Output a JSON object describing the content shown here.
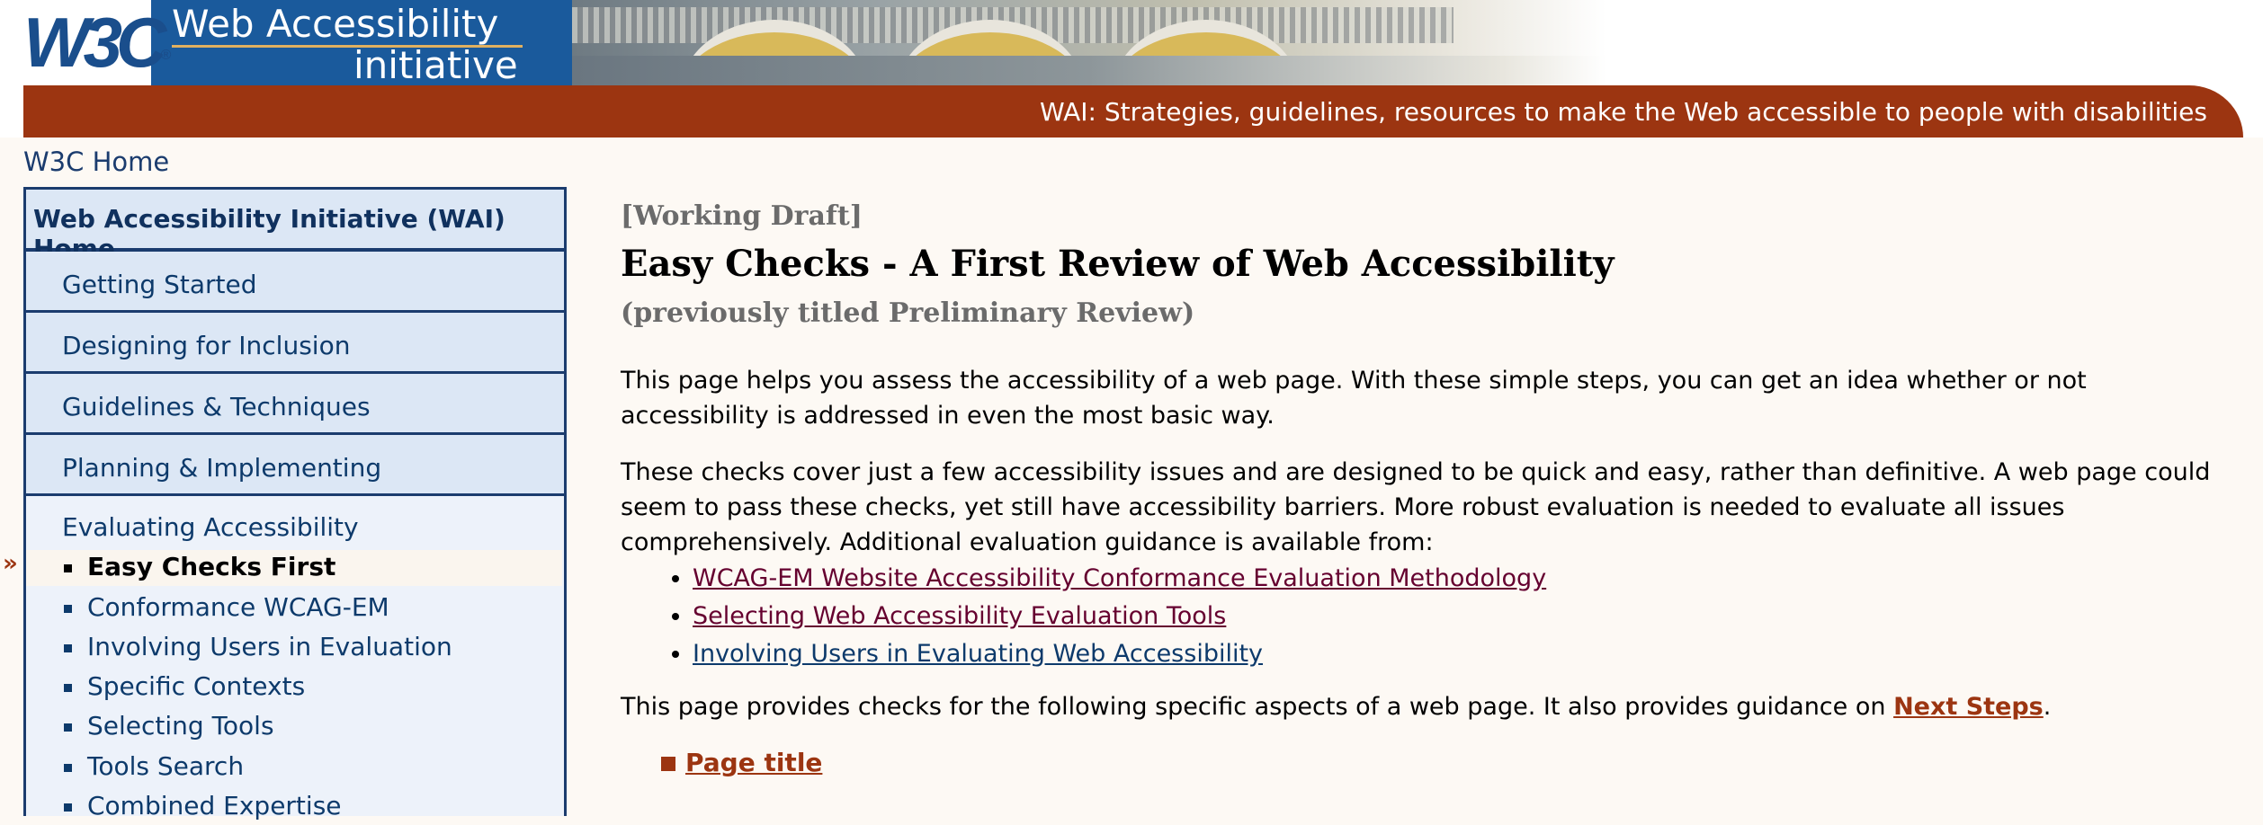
{
  "header": {
    "w3c_logo": "W3C",
    "w3c_logo_reg": "®",
    "wai_title_line1": "Web Accessibility",
    "wai_title_line2": "initiative",
    "tagline": "WAI: Strategies, guidelines, resources to make the Web accessible to people with disabilities"
  },
  "w3c_home": "W3C Home",
  "nav": {
    "home": "Web Accessibility Initiative (WAI) Home",
    "sections": [
      "Getting Started",
      "Designing for Inclusion",
      "Guidelines & Techniques",
      "Planning & Implementing",
      "Evaluating Accessibility"
    ],
    "current_marker": "»",
    "sub_items": [
      "Easy Checks First",
      "Conformance WCAG-EM",
      "Involving Users in Evaluation",
      "Specific Contexts",
      "Selecting Tools",
      "Tools Search",
      "Combined Expertise"
    ]
  },
  "main": {
    "draft_label": "[Working Draft]",
    "title": "Easy Checks - A First Review of Web Accessibility",
    "subtitle": "(previously titled Preliminary Review)",
    "p1": "This page helps you assess the accessibility of a web page. With these simple steps, you can get an idea whether or not accessibility is addressed in even the most basic way.",
    "p2": "These checks cover just a few accessibility issues and are designed to be quick and easy, rather than definitive. A web page could seem to pass these checks, yet still have accessibility barriers. More robust evaluation is needed to evaluate all issues comprehensively. Additional evaluation guidance is available from:",
    "links": [
      "WCAG-EM Website Accessibility Conformance Evaluation Methodology",
      "Selecting Web Accessibility Evaluation Tools",
      "Involving Users in Evaluating Web Accessibility"
    ],
    "p3_before": "This page provides checks for the following specific aspects of a web page. It also provides guidance on ",
    "p3_link": "Next Steps",
    "p3_after": ".",
    "toc_first": "Page title"
  },
  "colors": {
    "brand_blue": "#1a5a9c",
    "brand_rust": "#9c3511",
    "nav_border": "#1b3c6e",
    "page_bg": "#fdf9f4"
  }
}
